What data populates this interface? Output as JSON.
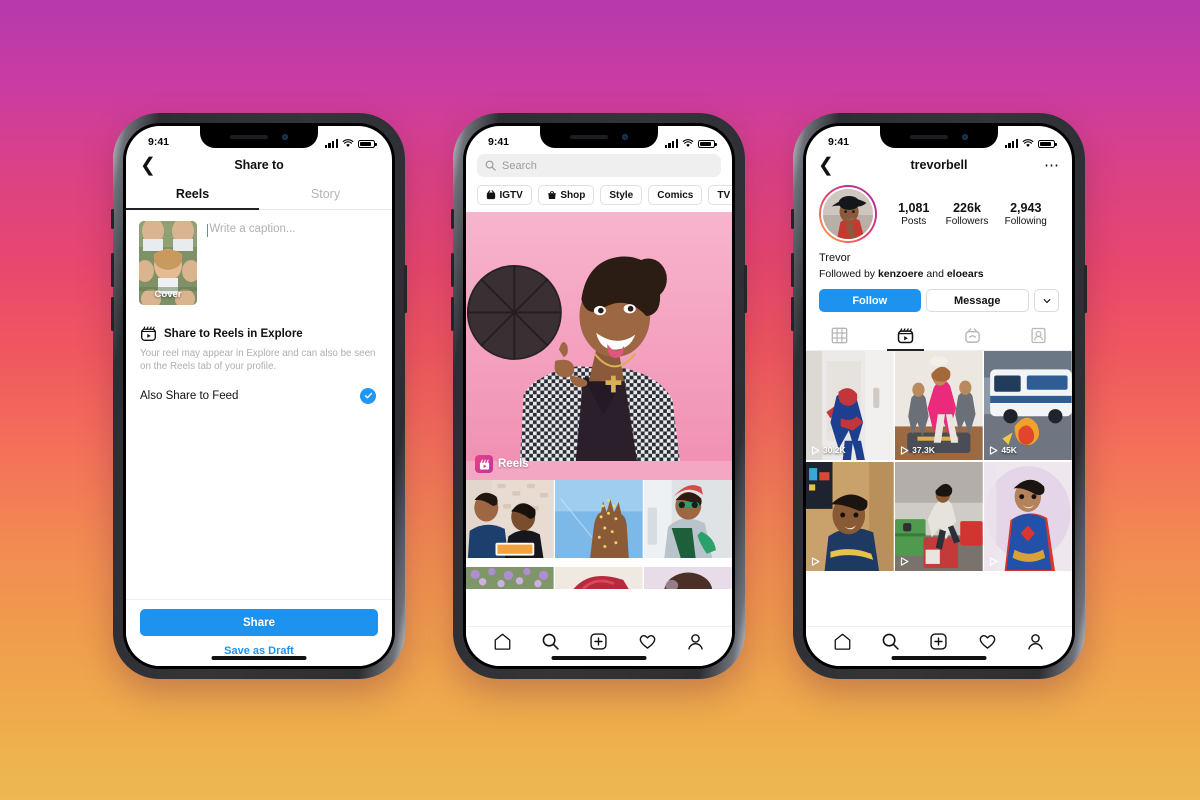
{
  "background": {
    "gradient_from": "#b53aab",
    "gradient_mid": "#f0575f",
    "gradient_to": "#edb851"
  },
  "accent": {
    "instagram_blue": "#1d93ef",
    "reels_pink": "#e8417d",
    "reels_purple": "#c034a6"
  },
  "status_bar": {
    "time": "9:41",
    "signal_icon": "cellular-bars-icon",
    "wifi_icon": "wifi-icon",
    "battery_icon": "battery-icon"
  },
  "phone1": {
    "label": "share-to-reels-screen",
    "header": {
      "back_icon": "chevron-left-icon",
      "title": "Share to"
    },
    "tabs": [
      {
        "label": "Reels",
        "active": true
      },
      {
        "label": "Story",
        "active": false
      }
    ],
    "compose": {
      "cover_label": "Cover",
      "caption_placeholder": "Write a caption...",
      "caption_value": ""
    },
    "explore_row": {
      "icon": "reels-outline-icon",
      "title": "Share to Reels in Explore",
      "description": "Your reel may appear in Explore and can also be seen on the Reels tab of your profile."
    },
    "feed_row": {
      "label": "Also Share to Feed",
      "checked": true,
      "check_icon": "check-circle-icon"
    },
    "footer": {
      "share_label": "Share",
      "draft_label": "Save as Draft"
    }
  },
  "phone2": {
    "label": "explore-screen",
    "search": {
      "placeholder": "Search",
      "value": "",
      "icon": "search-icon"
    },
    "chips": [
      {
        "label": "IGTV",
        "icon": "igtv-icon"
      },
      {
        "label": "Shop",
        "icon": "shopping-bag-icon"
      },
      {
        "label": "Style",
        "icon": ""
      },
      {
        "label": "Comics",
        "icon": ""
      },
      {
        "label": "TV & Movies",
        "icon": ""
      }
    ],
    "hero": {
      "badge_label": "Reels",
      "badge_icon": "reels-icon",
      "alt": "person spinning a basketball on a pink background"
    },
    "grid": [
      {
        "alt": "two people drawing at a table"
      },
      {
        "alt": "hand with glitter against blue sky"
      },
      {
        "alt": "person in beanie and sunglasses"
      },
      {
        "alt": "field of lavender flowers"
      },
      {
        "alt": "red satin fabric closeup"
      },
      {
        "alt": "portrait in soft light"
      }
    ],
    "nav": [
      {
        "icon": "home-icon",
        "label": "Home"
      },
      {
        "icon": "search-icon",
        "label": "Search"
      },
      {
        "icon": "plus-box-icon",
        "label": "Create"
      },
      {
        "icon": "heart-icon",
        "label": "Activity"
      },
      {
        "icon": "person-icon",
        "label": "Profile"
      }
    ]
  },
  "phone3": {
    "label": "profile-screen",
    "header": {
      "back_icon": "chevron-left-icon",
      "username": "trevorbell",
      "menu_icon": "more-options-icon"
    },
    "stats": [
      {
        "value": "1,081",
        "label": "Posts"
      },
      {
        "value": "226k",
        "label": "Followers"
      },
      {
        "value": "2,943",
        "label": "Following"
      }
    ],
    "display_name": "Trevor",
    "followed_by": {
      "prefix": "Followed by ",
      "first": "kenzoere",
      "middle": " and ",
      "second": "eloears"
    },
    "actions": {
      "follow_label": "Follow",
      "message_label": "Message",
      "caret_icon": "chevron-down-icon"
    },
    "tabs": [
      {
        "icon": "grid-icon",
        "active": false
      },
      {
        "icon": "reels-icon",
        "active": true
      },
      {
        "icon": "igtv-icon",
        "active": false
      },
      {
        "icon": "tagged-person-icon",
        "active": false
      }
    ],
    "videos": [
      {
        "views": "30.2K",
        "play_icon": "play-icon",
        "alt": "person in spiderman costume in hallway"
      },
      {
        "views": "37.3K",
        "play_icon": "play-icon",
        "alt": "group dance workout in living room"
      },
      {
        "views": "45K",
        "play_icon": "play-icon",
        "alt": "city bus on street with effects"
      },
      {
        "views": "",
        "play_icon": "play-icon",
        "alt": "person in navy shirt talking to camera"
      },
      {
        "views": "",
        "play_icon": "play-icon",
        "alt": "person box jumping in a gym"
      },
      {
        "views": "",
        "play_icon": "play-icon",
        "alt": "person in superhero costume"
      }
    ],
    "nav": [
      {
        "icon": "home-icon",
        "label": "Home"
      },
      {
        "icon": "search-icon",
        "label": "Search"
      },
      {
        "icon": "plus-box-icon",
        "label": "Create"
      },
      {
        "icon": "heart-icon",
        "label": "Activity"
      },
      {
        "icon": "person-icon",
        "label": "Profile"
      }
    ]
  }
}
